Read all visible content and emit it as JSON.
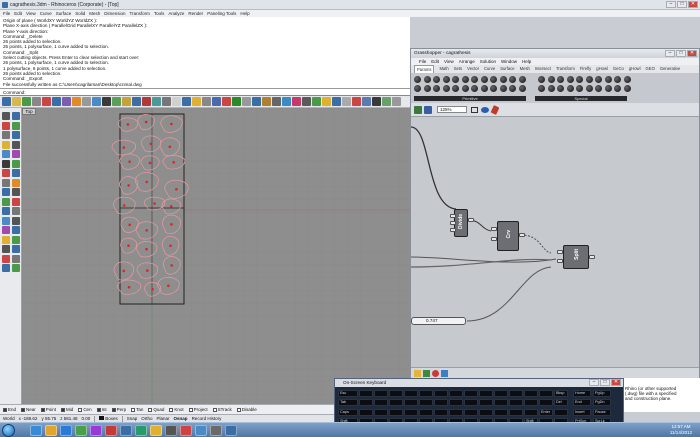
{
  "rhino": {
    "title": "cagrathesis.3dm - Rhinoceros (Corporate) - [Top]",
    "menu": [
      "File",
      "Edit",
      "View",
      "Curve",
      "Surface",
      "Solid",
      "Mesh",
      "Dimension",
      "Transform",
      "Tools",
      "Analyze",
      "Render",
      "Paneling Tools",
      "Help"
    ],
    "history": [
      "Origin of plane ( WorldXY  WorldYZ  WorldZX ):",
      "Plane X-axis direction ( ParallelGrid  ParallelXY  ParallelYZ  ParallelZX ):",
      "Plane Y-axis direction:",
      "Command: _Delete",
      "26 points added to selection.",
      "25 points, 1 polysurface, 1 curve added to selection.",
      "Command: _Split",
      "Select cutting objects. Press Enter to clear selection and start over:",
      "26 points, 1 polysurface, 1 curve added to selection.",
      "1 polysurface, 6 points, 1 curve added to selection.",
      "26 points added to selection.",
      "Command: _Export",
      "File successfully written as C:\\Users\\cagrilarsan\\Desktop\\cnmal.dwg"
    ],
    "command_prompt": "Command:",
    "viewport_tab": "Top",
    "osnaps": [
      {
        "label": "End",
        "on": true
      },
      {
        "label": "Near",
        "on": true
      },
      {
        "label": "Point",
        "on": true
      },
      {
        "label": "Mid",
        "on": true
      },
      {
        "label": "Cen",
        "on": false
      },
      {
        "label": "Int",
        "on": true
      },
      {
        "label": "Perp",
        "on": true
      },
      {
        "label": "Tan",
        "on": false
      },
      {
        "label": "Quad",
        "on": false
      },
      {
        "label": "Knot",
        "on": false
      },
      {
        "label": "Project",
        "on": false
      },
      {
        "label": "STrack",
        "on": false
      },
      {
        "label": "Disable",
        "on": false
      }
    ],
    "status": {
      "cplane": "World",
      "x": "x -188.62",
      "y": "y 55.75",
      "z": "z 581.48",
      "units": "0.00",
      "layer": "Boxes",
      "snap": "Snap",
      "ortho": "Ortho",
      "planar": "Planar",
      "osnap": "Osnap",
      "record": "Record History"
    }
  },
  "grasshopper": {
    "title": "Grasshopper - cagrathesis",
    "menu": [
      "File",
      "Edit",
      "View",
      "Arrange",
      "Solution",
      "Window",
      "Help"
    ],
    "tabs": [
      "Params",
      "Math",
      "Sets",
      "Vector",
      "Curve",
      "Surface",
      "Mesh",
      "Intersect",
      "Transform",
      "Firefly",
      "gHowl",
      "GeCo",
      "gHowl",
      "GEO",
      "Generative"
    ],
    "active_tab": "Params",
    "ribbon_labels": [
      "Primitive",
      "Special"
    ],
    "zoom": "125%",
    "components": {
      "divide": "Divide",
      "crv": "Crv",
      "split": "Split"
    },
    "slider_value": "0.747",
    "notes": [
      "Rhino (or other supported",
      "(.dwg) file with a specified",
      "and construction plane."
    ]
  },
  "keyboard": {
    "title": "On-Screen Keyboard",
    "rows": [
      [
        "Esc",
        "",
        "",
        "",
        "",
        "",
        "",
        "",
        "",
        "",
        "",
        "",
        "",
        "",
        "Bksp",
        "Home",
        "PgUp"
      ],
      [
        "Tab",
        "",
        "",
        "",
        "",
        "",
        "",
        "",
        "",
        "",
        "",
        "",
        "",
        "",
        "Del",
        "End",
        "PgDn"
      ],
      [
        "Caps",
        "",
        "",
        "",
        "",
        "",
        "",
        "",
        "",
        "",
        "",
        "",
        "",
        "Enter",
        "",
        "Insert",
        "Pause"
      ],
      [
        "Shift",
        "",
        "",
        "",
        "",
        "",
        "",
        "",
        "",
        "",
        "",
        "",
        "Shift",
        "",
        "",
        "PrtScn",
        "ScrLk"
      ],
      [
        "Ctrl",
        "",
        "Alt",
        "",
        "",
        "",
        "",
        "",
        "",
        "",
        "Alt",
        "",
        "Ctrl",
        "",
        "",
        "Options",
        "Help"
      ]
    ]
  },
  "taskbar": {
    "time": "12:57 AM",
    "date": "11/14/2012"
  },
  "colors": {
    "taskbar": "#4f77a6",
    "viewport": "#8e8e8e",
    "curve": "#e89aa0",
    "point": "#d62828"
  }
}
